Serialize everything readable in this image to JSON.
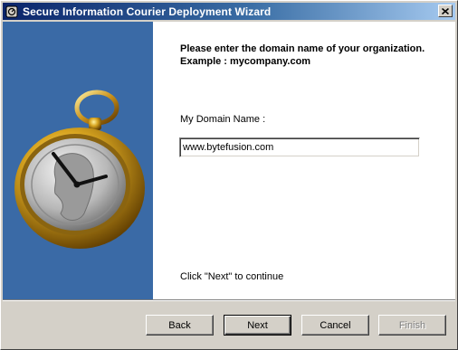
{
  "window": {
    "title": "Secure Information Courier Deployment Wizard",
    "app_icon": "app-icon",
    "close_icon": "close-icon"
  },
  "colors": {
    "titlebar_start": "#0a246a",
    "titlebar_end": "#a6caf0",
    "side_panel": "#3a6aa6",
    "window_bg": "#d4d0c8"
  },
  "banner": {
    "image": "pocket-watch-illustration"
  },
  "page": {
    "heading": "Please enter the domain name of your organization. Example : mycompany.com",
    "domain_label": "My Domain Name :",
    "domain_value": "www.bytefusion.com",
    "continue_hint": "Click \"Next\" to continue"
  },
  "buttons": {
    "back": "Back",
    "next": "Next",
    "cancel": "Cancel",
    "finish": "Finish"
  }
}
